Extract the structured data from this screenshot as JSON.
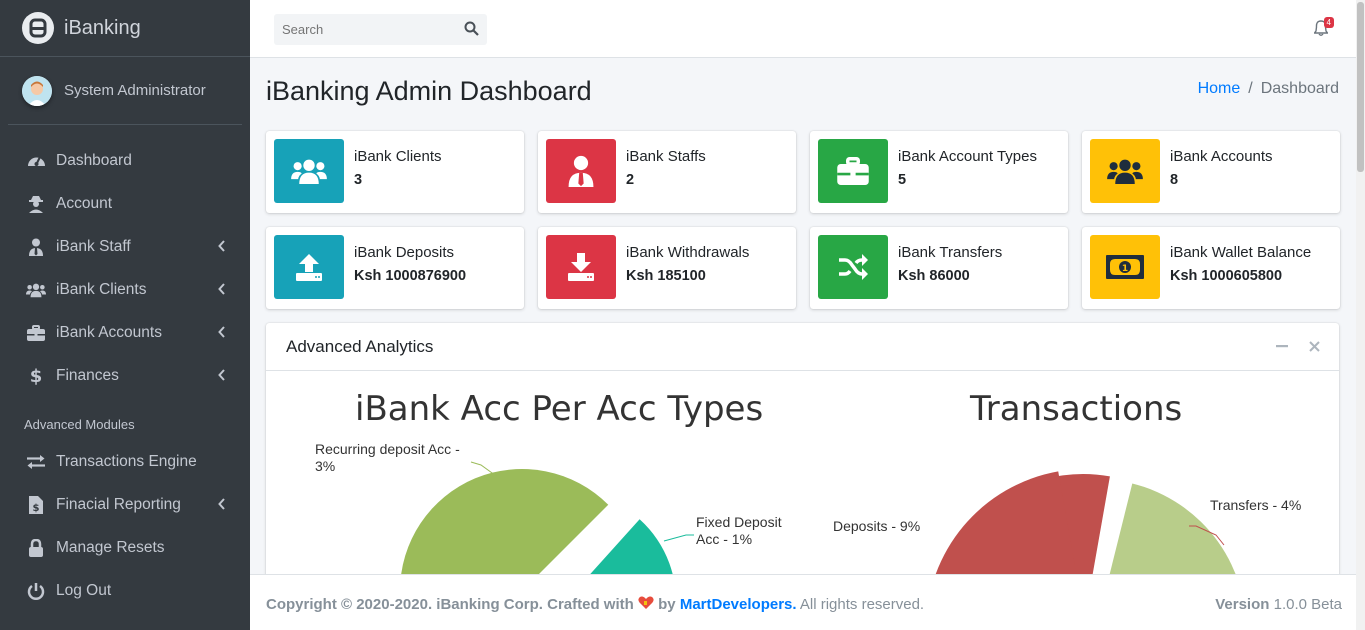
{
  "brand": {
    "name": "iBanking"
  },
  "user": {
    "name": "System Administrator"
  },
  "sidebar": {
    "items": [
      {
        "label": "Dashboard",
        "icon": "tachometer-icon"
      },
      {
        "label": "Account",
        "icon": "user-secret-icon"
      },
      {
        "label": "iBank Staff",
        "icon": "user-tie-icon",
        "expandable": true
      },
      {
        "label": "iBank Clients",
        "icon": "users-icon",
        "expandable": true
      },
      {
        "label": "iBank Accounts",
        "icon": "briefcase-icon",
        "expandable": true
      },
      {
        "label": "Finances",
        "icon": "dollar-icon",
        "expandable": true
      }
    ],
    "header": "Advanced Modules",
    "advanced": [
      {
        "label": "Transactions Engine",
        "icon": "exchange-icon"
      },
      {
        "label": "Finacial Reporting",
        "icon": "file-invoice-dollar-icon",
        "expandable": true
      },
      {
        "label": "Manage Resets",
        "icon": "lock-icon"
      },
      {
        "label": "Log Out",
        "icon": "power-off-icon"
      }
    ]
  },
  "topbar": {
    "search_placeholder": "Search",
    "notification_count": "4"
  },
  "page": {
    "title": "iBanking Admin Dashboard",
    "breadcrumb_home": "Home",
    "breadcrumb_current": "Dashboard"
  },
  "stats": [
    {
      "label": "iBank Clients",
      "value": "3",
      "color": "#17a2b8",
      "icon": "users-icon"
    },
    {
      "label": "iBank Staffs",
      "value": "2",
      "color": "#dc3545",
      "icon": "user-tie-icon"
    },
    {
      "label": "iBank Account Types",
      "value": "5",
      "color": "#28a745",
      "icon": "briefcase-icon"
    },
    {
      "label": "iBank Accounts",
      "value": "8",
      "color": "#ffc107",
      "icon": "users-icon"
    },
    {
      "label": "iBank Deposits",
      "value": "Ksh 1000876900",
      "color": "#17a2b8",
      "icon": "upload-icon"
    },
    {
      "label": "iBank Withdrawals",
      "value": "Ksh 185100",
      "color": "#dc3545",
      "icon": "download-icon"
    },
    {
      "label": "iBank Transfers",
      "value": "Ksh 86000",
      "color": "#28a745",
      "icon": "random-icon"
    },
    {
      "label": "iBank Wallet Balance",
      "value": "Ksh 1000605800",
      "color": "#ffc107",
      "icon": "money-bill-icon"
    }
  ],
  "analytics": {
    "title": "Advanced Analytics"
  },
  "chart_data": [
    {
      "type": "pie",
      "title": "iBank Acc Per Acc Types",
      "slices": [
        {
          "label": "Recurring deposit Acc  - 3%",
          "value": 3,
          "color": "#9bbb59"
        },
        {
          "label": "Fixed Deposit Acc - 1%",
          "value": 1,
          "color": "#1abc9c"
        }
      ]
    },
    {
      "type": "pie",
      "title": "Transactions",
      "slices": [
        {
          "label": "Deposits - 9%",
          "value": 9,
          "color": "#c0504d"
        },
        {
          "label": "Transfers - 4%",
          "value": 4,
          "color": "#b8cd8a"
        }
      ]
    }
  ],
  "footer": {
    "copyright": "Copyright © 2020-2020. iBanking Corp. Crafted with",
    "by": "by",
    "author": "MartDevelopers.",
    "rights": "All rights reserved.",
    "version_label": "Version",
    "version": "1.0.0 Beta"
  }
}
